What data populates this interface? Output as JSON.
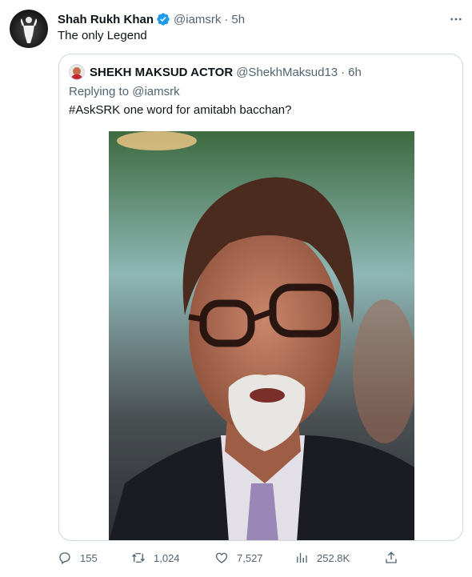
{
  "tweet": {
    "author_name": "Shah Rukh Khan",
    "author_handle": "@iamsrk",
    "separator": "·",
    "time": "5h",
    "text": "The only Legend",
    "verified_color": "#1d9bf0"
  },
  "quoted_tweet": {
    "author_name": "SHEKH MAKSUD ACTOR",
    "author_handle": "@ShekhMaksud13",
    "separator": "·",
    "time": "6h",
    "replying_prefix": "Replying to",
    "replying_to": "@iamsrk",
    "text": "#AskSRK one word for amitabh bacchan?",
    "photo_icon": "portrait-photo"
  },
  "actions": {
    "replies": "155",
    "retweets": "1,024",
    "likes": "7,527",
    "views": "252.8K"
  },
  "icons": {
    "reply": "reply-icon",
    "retweet": "retweet-icon",
    "like": "heart-icon",
    "views": "views-icon",
    "share": "share-icon",
    "more": "more-icon"
  },
  "colors": {
    "text": "#0f1419",
    "secondary": "#536471",
    "border": "#cfd9de",
    "accent": "#1d9bf0"
  }
}
